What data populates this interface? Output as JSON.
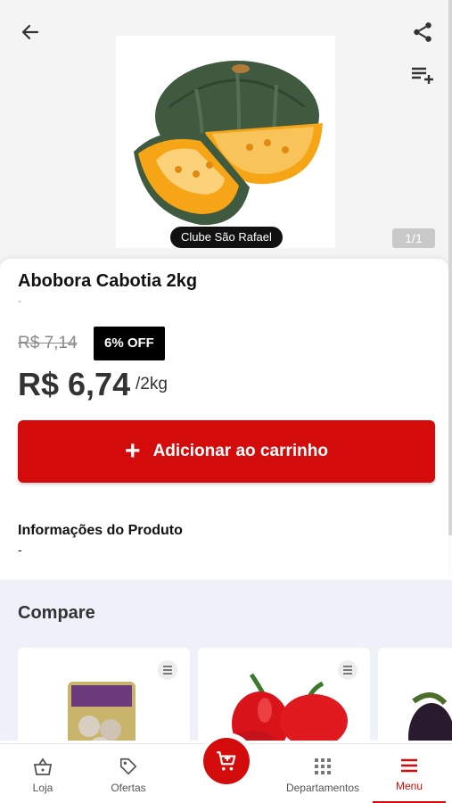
{
  "header": {
    "back_icon": "arrow-left-icon",
    "share_icon": "share-icon",
    "add_to_list_icon": "playlist-add-icon"
  },
  "gallery": {
    "club_badge": "Clube São Rafael",
    "counter": "1/1"
  },
  "product": {
    "name": "Abobora Cabotia 2kg",
    "subtitle": "-",
    "old_price": "R$ 7,14",
    "discount_badge": "6% OFF",
    "price": "R$ 6,74",
    "unit": "/2kg",
    "add_to_cart_label": "Adicionar ao carrinho",
    "info_title": "Informações do Produto",
    "info_value": "-"
  },
  "compare": {
    "title": "Compare"
  },
  "bottom_nav": {
    "items": [
      {
        "label": "Loja",
        "icon": "basket-icon"
      },
      {
        "label": "Ofertas",
        "icon": "tag-icon"
      },
      {
        "label": "Departamentos",
        "icon": "grid-icon"
      },
      {
        "label": "Menu",
        "icon": "hamburger-icon"
      }
    ],
    "cart_icon": "cart-icon"
  },
  "colors": {
    "accent": "#d40b0b",
    "compare_bg": "#eef0fa"
  }
}
